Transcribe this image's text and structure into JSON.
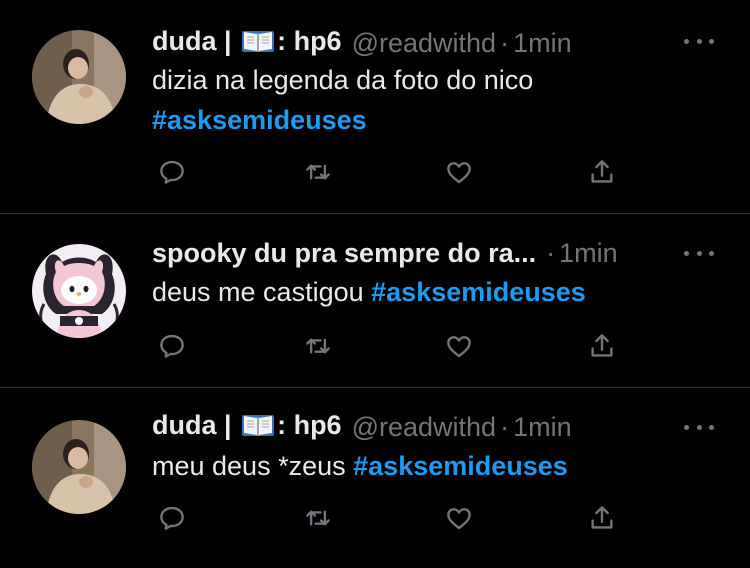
{
  "tweets": [
    {
      "name": "duda |",
      "name_suffix": ": hp6",
      "handle": "@readwithd",
      "separator": "·",
      "time": "1min",
      "text": "dizia na legenda da foto do nico",
      "hashtag": "#asksemideuses",
      "avatar": "person-photo"
    },
    {
      "name": "spooky du pra sempre do ra...",
      "separator": "·",
      "time": "1min",
      "text": "deus me castigou",
      "hashtag": "#asksemideuses",
      "avatar": "my-melody-kuromi"
    },
    {
      "name": "duda |",
      "name_suffix": ": hp6",
      "handle": "@readwithd",
      "separator": "·",
      "time": "1min",
      "text": "meu deus *zeus",
      "hashtag": "#asksemideuses",
      "avatar": "person-photo"
    }
  ],
  "icons": {
    "reply": "reply-icon",
    "retweet": "retweet-icon",
    "like": "heart-icon",
    "share": "share-icon",
    "more": "more-icon",
    "book": "book-emoji-icon"
  },
  "colors": {
    "background": "#000000",
    "text": "#e7e9ea",
    "muted": "#71767b",
    "hashtag": "#1d9bf0",
    "divider": "#2f3336"
  }
}
